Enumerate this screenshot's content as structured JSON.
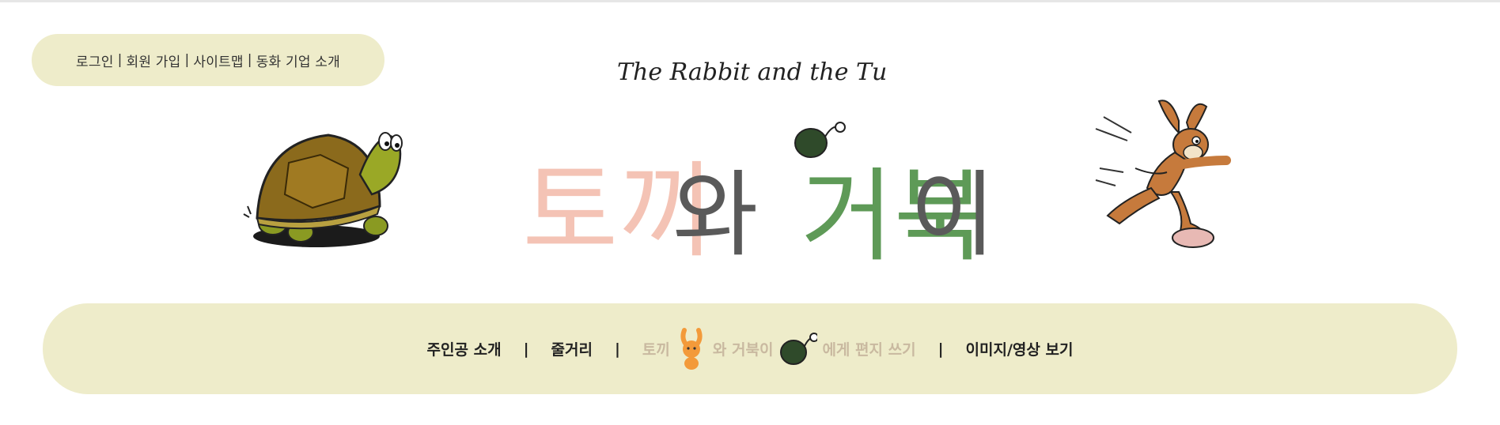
{
  "top_links": [
    {
      "label": "로그인"
    },
    {
      "label": "회원 가입"
    },
    {
      "label": "사이트맵"
    },
    {
      "label": "동화 기업 소개"
    }
  ],
  "top_links_separator": "|",
  "header": {
    "subtitle": "The Rabbit and the Turtle",
    "title_part1": "토끼",
    "title_part2": "와",
    "title_part3": "거북",
    "title_part4": "이"
  },
  "nav": {
    "separator": "|",
    "item1": "주인공 소개",
    "item2": "줄거리",
    "item3_a": "토끼",
    "item3_b": "와 거북이",
    "item3_c": "에게 편지 쓰기",
    "item4": "이미지/영상 보기"
  },
  "colors": {
    "pill_bg": "#eeecca",
    "title_pink": "#f4c3b5",
    "title_green": "#5e9a57",
    "title_gray": "#5a5a5a",
    "nav_muted": "#c9b9a0"
  }
}
